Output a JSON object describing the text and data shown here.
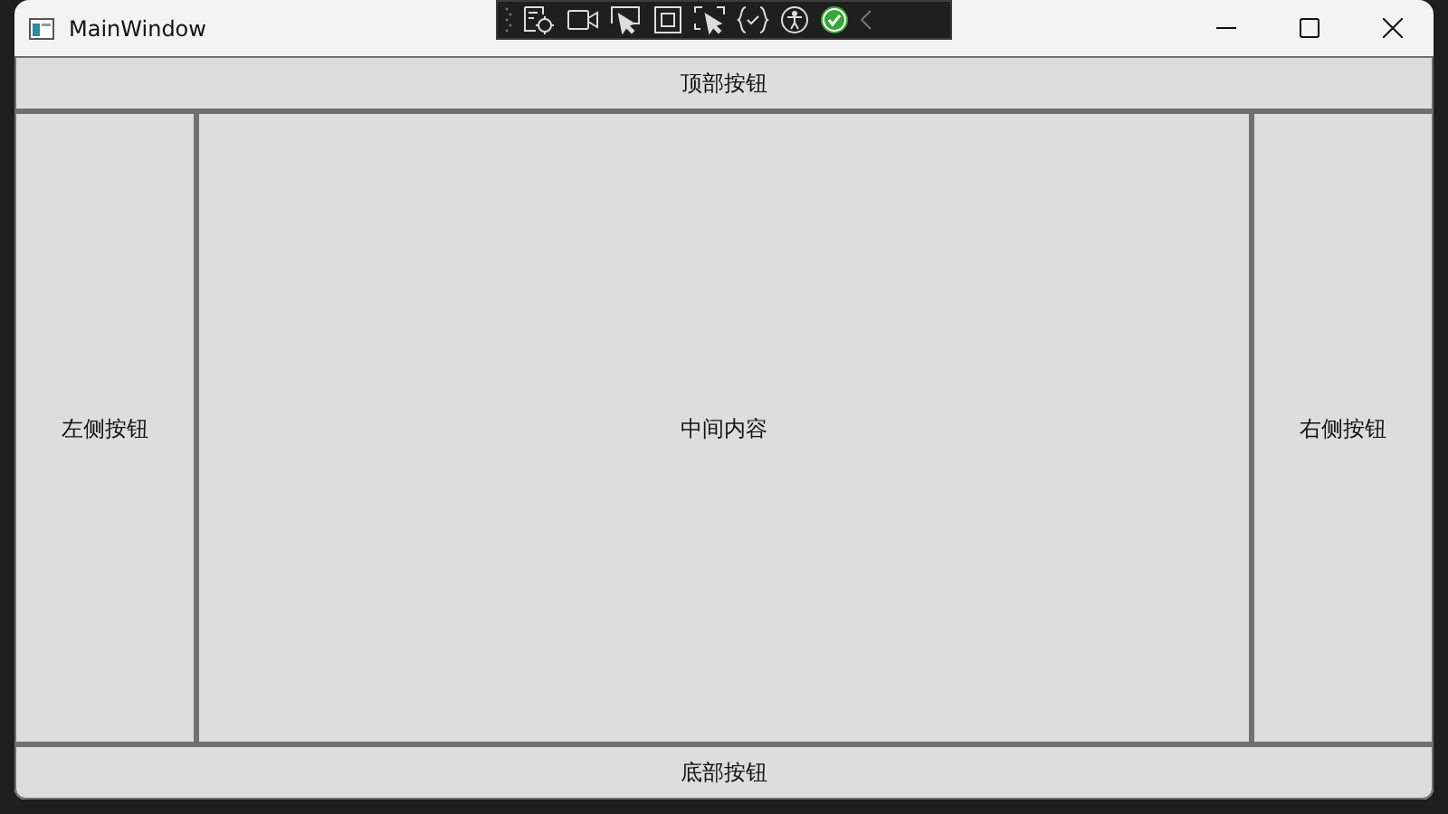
{
  "window": {
    "title": "MainWindow"
  },
  "dock": [
    {
      "kind": "top",
      "label": "顶部按钮"
    },
    {
      "kind": "left",
      "label": "左侧按钮"
    },
    {
      "kind": "fill",
      "label": "中间内容"
    },
    {
      "kind": "right",
      "label": "右侧按钮"
    },
    {
      "kind": "bottom",
      "label": "底部按钮"
    }
  ]
}
